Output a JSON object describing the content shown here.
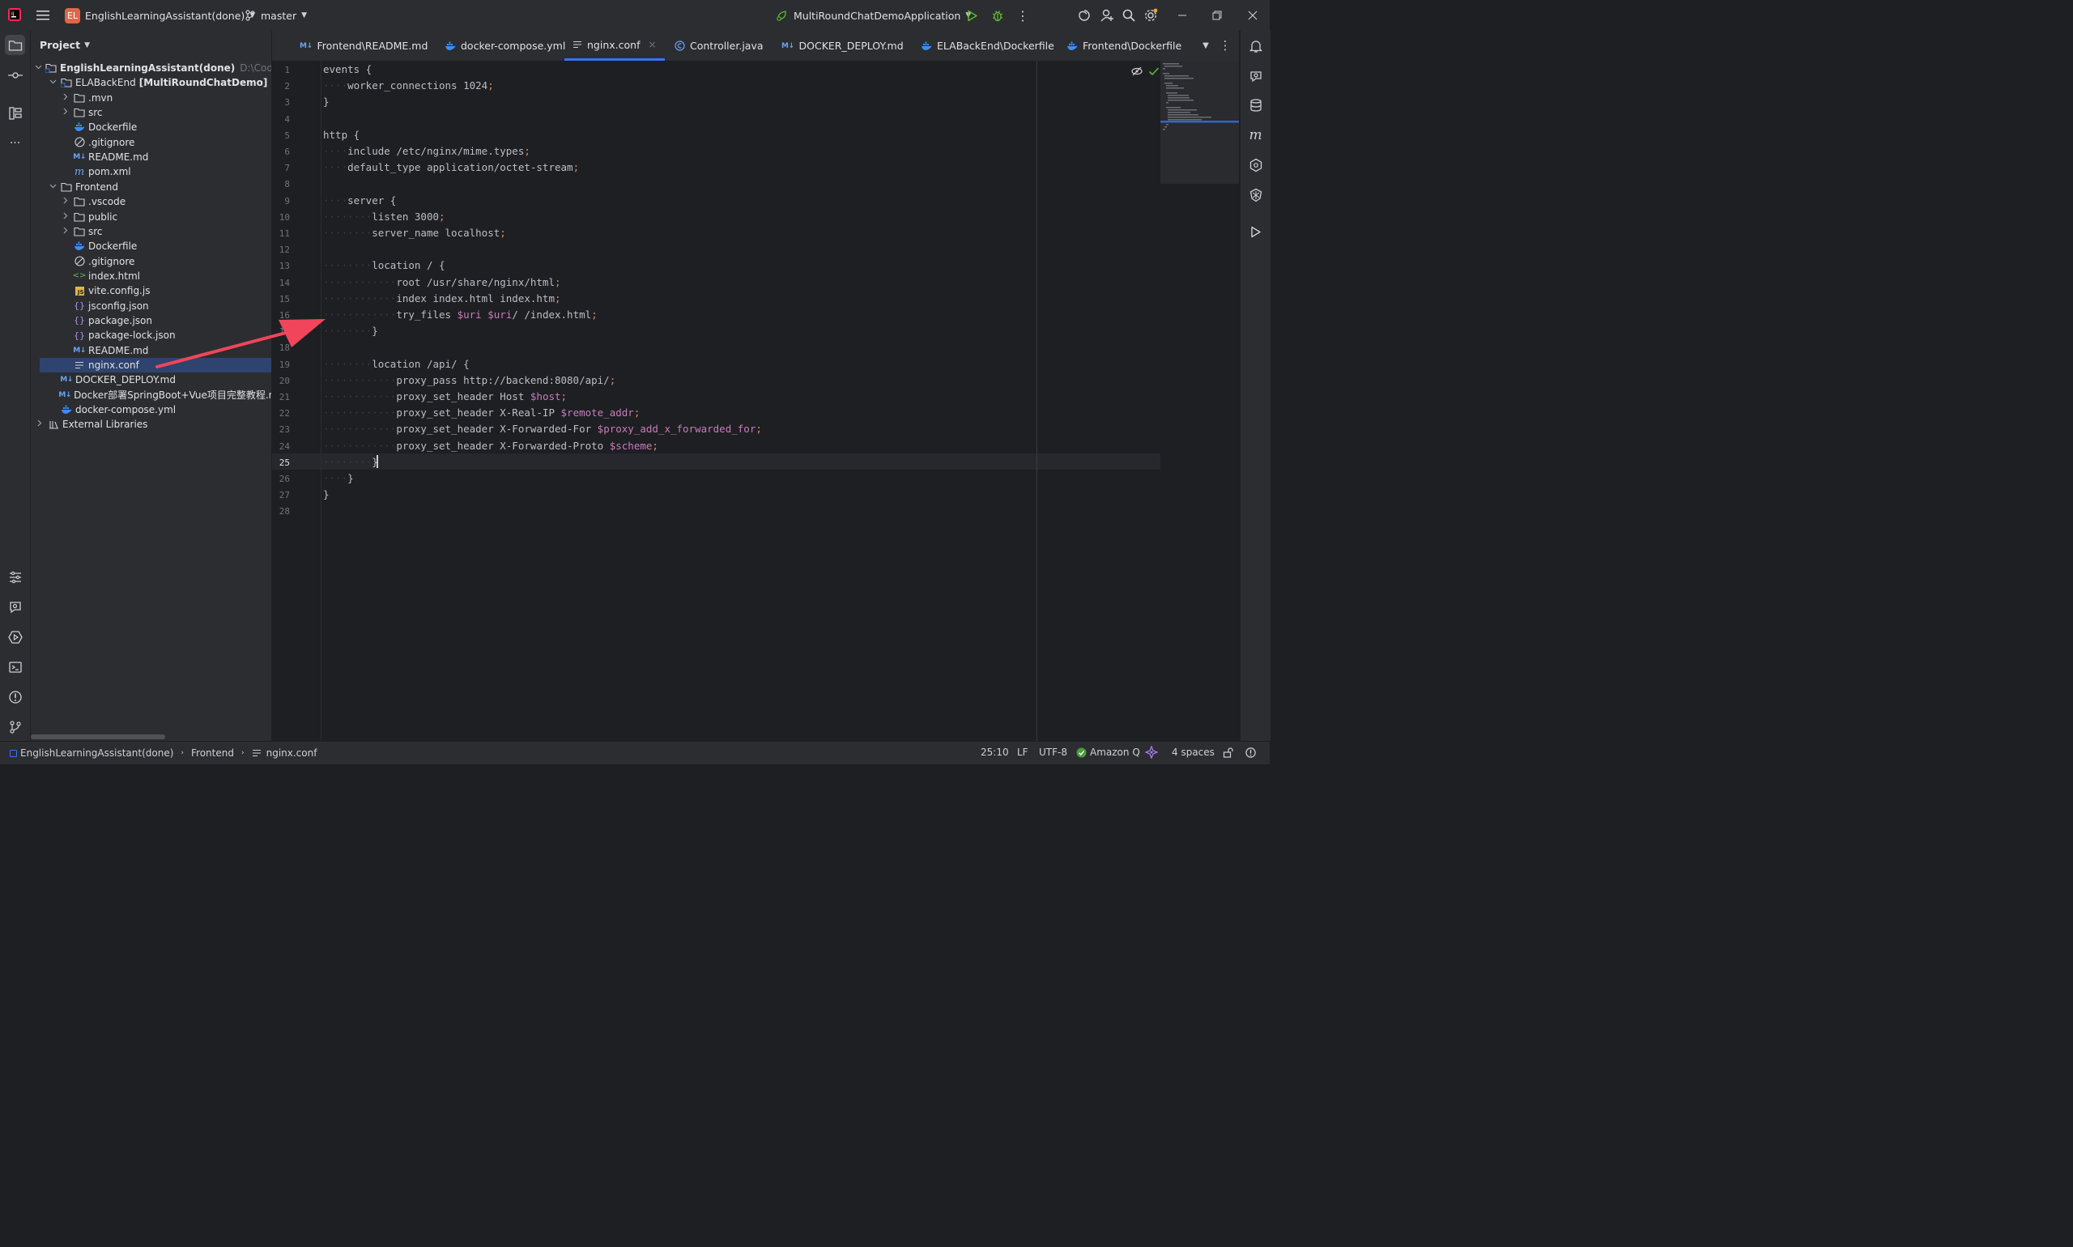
{
  "titlebar": {
    "project_badge": "EL",
    "project_name": "EnglishLearningAssistant(done)",
    "branch": "master",
    "run_config": "MultiRoundChatDemoApplication"
  },
  "project_panel": {
    "title": "Project",
    "root_path": "D:\\Code\\Apps\\",
    "items": [
      {
        "label": "EnglishLearningAssistant(done)",
        "bold": true,
        "indent": 0,
        "chevron": "down",
        "icon": "module-folder-icon"
      },
      {
        "label": "ELABackEnd",
        "suffix": "[MultiRoundChatDemo]",
        "indent": 1,
        "chevron": "down",
        "icon": "module-folder-icon"
      },
      {
        "label": ".mvn",
        "indent": 2,
        "chevron": "right",
        "icon": "folder-icon"
      },
      {
        "label": "src",
        "indent": 2,
        "chevron": "right",
        "icon": "folder-icon"
      },
      {
        "label": "Dockerfile",
        "indent": 2,
        "chevron": "",
        "icon": "docker-icon"
      },
      {
        "label": ".gitignore",
        "indent": 2,
        "chevron": "",
        "icon": "ignore-icon"
      },
      {
        "label": "README.md",
        "indent": 2,
        "chevron": "",
        "icon": "markdown-icon"
      },
      {
        "label": "pom.xml",
        "indent": 2,
        "chevron": "",
        "icon": "maven-icon"
      },
      {
        "label": "Frontend",
        "indent": 1,
        "chevron": "down",
        "icon": "folder-icon"
      },
      {
        "label": ".vscode",
        "indent": 2,
        "chevron": "right",
        "icon": "folder-icon"
      },
      {
        "label": "public",
        "indent": 2,
        "chevron": "right",
        "icon": "folder-icon"
      },
      {
        "label": "src",
        "indent": 2,
        "chevron": "right",
        "icon": "folder-icon"
      },
      {
        "label": "Dockerfile",
        "indent": 2,
        "chevron": "",
        "icon": "docker-icon"
      },
      {
        "label": ".gitignore",
        "indent": 2,
        "chevron": "",
        "icon": "ignore-icon"
      },
      {
        "label": "index.html",
        "indent": 2,
        "chevron": "",
        "icon": "html-icon"
      },
      {
        "label": "vite.config.js",
        "indent": 2,
        "chevron": "",
        "icon": "js-icon"
      },
      {
        "label": "jsconfig.json",
        "indent": 2,
        "chevron": "",
        "icon": "json-icon"
      },
      {
        "label": "package.json",
        "indent": 2,
        "chevron": "",
        "icon": "json-icon"
      },
      {
        "label": "package-lock.json",
        "indent": 2,
        "chevron": "",
        "icon": "json-icon"
      },
      {
        "label": "README.md",
        "indent": 2,
        "chevron": "",
        "icon": "markdown-icon"
      },
      {
        "label": "nginx.conf",
        "indent": 2,
        "chevron": "",
        "icon": "text-file-icon",
        "selected": true
      },
      {
        "label": "DOCKER_DEPLOY.md",
        "indent": 1,
        "chevron": "",
        "icon": "markdown-icon"
      },
      {
        "label": "Docker部署SpringBoot+Vue项目完整教程.md",
        "indent": 1,
        "chevron": "",
        "icon": "markdown-icon"
      },
      {
        "label": "docker-compose.yml",
        "indent": 1,
        "chevron": "",
        "icon": "docker-icon"
      },
      {
        "label": "External Libraries",
        "indent": 0,
        "chevron": "right",
        "icon": "library-icon"
      }
    ]
  },
  "tabs": [
    {
      "label": "Frontend\\README.md",
      "icon": "markdown-icon"
    },
    {
      "label": "docker-compose.yml",
      "icon": "docker-icon"
    },
    {
      "label": "nginx.conf",
      "icon": "text-file-icon",
      "active": true
    },
    {
      "label": "Controller.java",
      "icon": "class-icon"
    },
    {
      "label": "DOCKER_DEPLOY.md",
      "icon": "markdown-icon"
    },
    {
      "label": "ELABackEnd\\Dockerfile",
      "icon": "docker-icon"
    },
    {
      "label": "Frontend\\Dockerfile",
      "icon": "docker-icon"
    }
  ],
  "code_lines": [
    "events {",
    "    worker_connections 1024;",
    "}",
    "",
    "http {",
    "    include /etc/nginx/mime.types;",
    "    default_type application/octet-stream;",
    "",
    "    server {",
    "        listen 3000;",
    "        server_name localhost;",
    "",
    "        location / {",
    "            root /usr/share/nginx/html;",
    "            index index.html index.htm;",
    "            try_files $uri $uri/ /index.html;",
    "        }",
    "",
    "        location /api/ {",
    "            proxy_pass http://backend:8080/api/;",
    "            proxy_set_header Host $host;",
    "            proxy_set_header X-Real-IP $remote_addr;",
    "            proxy_set_header X-Forwarded-For $proxy_add_x_forwarded_for;",
    "            proxy_set_header X-Forwarded-Proto $scheme;",
    "        }",
    "    }",
    "}",
    ""
  ],
  "current_line": 25,
  "statusbar": {
    "breadcrumb": [
      "EnglishLearningAssistant(done)",
      "Frontend",
      "nginx.conf"
    ],
    "position": "25:10",
    "line_sep": "LF",
    "encoding": "UTF-8",
    "plugin": "Amazon Q",
    "indent": "4 spaces"
  },
  "colors": {
    "accent": "#3574f0",
    "annotation_arrow": "#f0455a",
    "selection": "#2e436e",
    "badge": "#e0664b"
  }
}
